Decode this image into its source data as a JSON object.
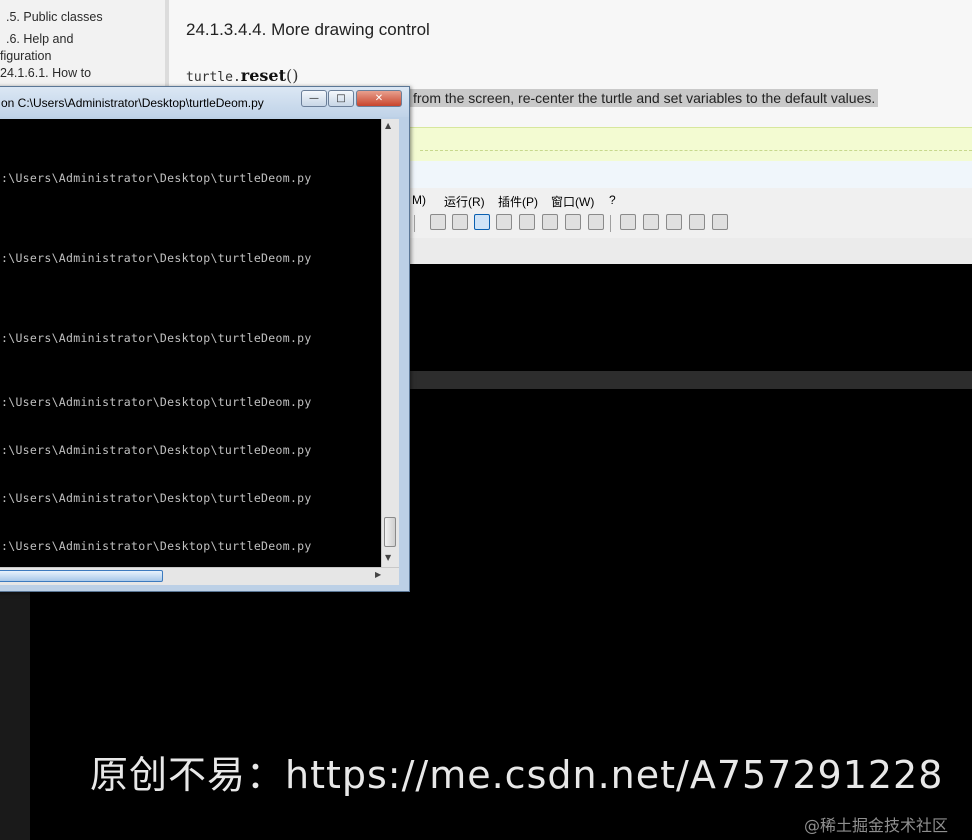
{
  "doc": {
    "sidebar_items": [
      ".5. Public classes",
      ".6. Help and",
      "figuration",
      "24.1.6.1. How to"
    ],
    "heading": "24.1.3.4.4. More drawing control",
    "code_prefix": "turtle.",
    "code_fn": "reset",
    "code_parens": "()",
    "description": "from the screen, re-center the turtle and set variables to the default values."
  },
  "editor": {
    "menu": [
      "M)",
      "运行(R)",
      "插件(P)",
      "窗口(W)",
      "?"
    ]
  },
  "console": {
    "title": "on  C:\\Users\\Administrator\\Desktop\\turtleDeom.py",
    "minimize_glyph": "—",
    "maximize_glyph": "□",
    "close_glyph": "✕",
    "lines": [
      ":\\Users\\Administrator\\Desktop\\turtleDeom.py",
      ":\\Users\\Administrator\\Desktop\\turtleDeom.py",
      ":\\Users\\Administrator\\Desktop\\turtleDeom.py",
      ":\\Users\\Administrator\\Desktop\\turtleDeom.py",
      ":\\Users\\Administrator\\Desktop\\turtleDeom.py",
      ":\\Users\\Administrator\\Desktop\\turtleDeom.py",
      ":\\Users\\Administrator\\Desktop\\turtleDeom.py"
    ]
  },
  "overlay": {
    "watermark": "原创不易：https://me.csdn.net/A757291228",
    "site_mark": "@稀土掘金技术社区"
  }
}
